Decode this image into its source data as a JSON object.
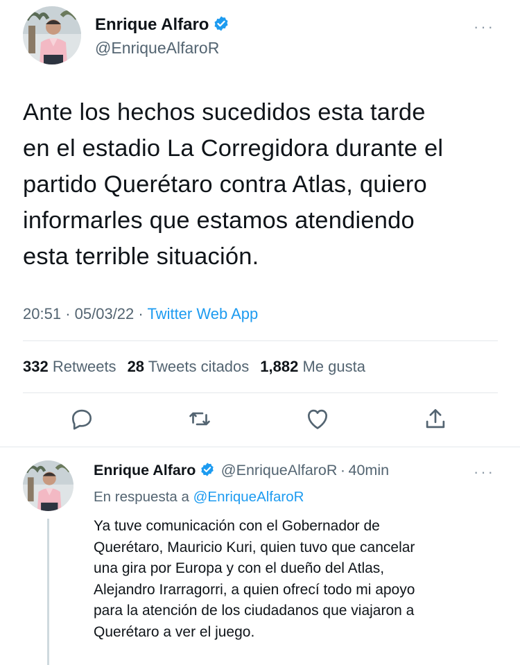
{
  "tweet": {
    "author_name": "Enrique Alfaro",
    "author_handle": "@EnriqueAlfaroR",
    "verified_icon": "verified-badge-icon",
    "more_icon": "more-options-icon",
    "more_glyph": "···",
    "lines": [
      "Ante los hechos sucedidos esta tarde",
      "en el estadio La Corregidora durante el",
      "partido Querétaro contra Atlas, quiero",
      "informarles que estamos atendiendo",
      "esta terrible situación."
    ],
    "time": "20:51",
    "date": "05/03/22",
    "separator": "·",
    "source": "Twitter Web App",
    "stats": {
      "retweets_count": "332",
      "retweets_label": "Retweets",
      "quotes_count": "28",
      "quotes_label": "Tweets citados",
      "likes_count": "1,882",
      "likes_label": "Me gusta"
    },
    "actions": [
      "reply-icon",
      "retweet-icon",
      "like-icon",
      "share-icon"
    ]
  },
  "reply": {
    "author_name": "Enrique Alfaro",
    "author_handle": "@EnriqueAlfaroR",
    "separator": "·",
    "time_ago": "40min",
    "more_glyph": "···",
    "replying_prefix": "En respuesta a",
    "replying_to": "@EnriqueAlfaroR",
    "lines": [
      "Ya tuve comunicación con el Gobernador de",
      "Querétaro, Mauricio Kuri, quien tuvo que cancelar",
      "una gira por Europa y con el dueño del Atlas,",
      "Alejandro Irarragorri, a quien ofrecí todo mi apoyo",
      "para la atención de los ciudadanos que viajaron a",
      "Querétaro a ver el juego."
    ]
  },
  "colors": {
    "accent": "#1d9bf0",
    "text": "#0f1419",
    "secondary": "#536471",
    "divider": "#e3e8eb"
  }
}
